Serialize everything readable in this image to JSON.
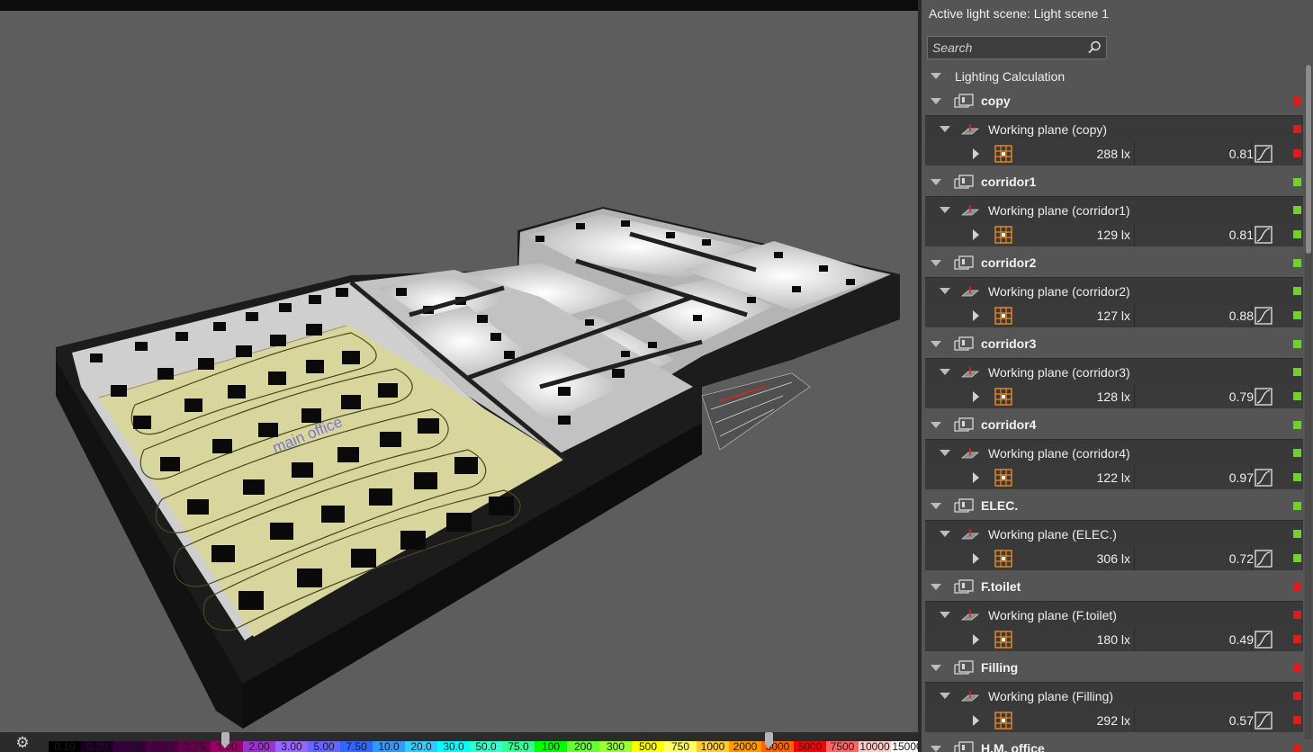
{
  "panel": {
    "active_scene_label": "Active light scene: Light scene 1",
    "search_placeholder": "Search"
  },
  "tree": {
    "calc_label": "Lighting Calculation",
    "status_colors": {
      "red": "#e11b1b",
      "green": "#6fd22a"
    },
    "items": [
      {
        "name": "copy",
        "plane": "Working plane (copy)",
        "lux": "288 lx",
        "uniformity": "0.81",
        "status": "red"
      },
      {
        "name": "corridor1",
        "plane": "Working plane (corridor1)",
        "lux": "129 lx",
        "uniformity": "0.81",
        "status": "green"
      },
      {
        "name": "corridor2",
        "plane": "Working plane (corridor2)",
        "lux": "127 lx",
        "uniformity": "0.88",
        "status": "green"
      },
      {
        "name": "corridor3",
        "plane": "Working plane (corridor3)",
        "lux": "128 lx",
        "uniformity": "0.79",
        "status": "green"
      },
      {
        "name": "corridor4",
        "plane": "Working plane (corridor4)",
        "lux": "122 lx",
        "uniformity": "0.97",
        "status": "green"
      },
      {
        "name": "ELEC.",
        "plane": "Working plane (ELEC.)",
        "lux": "306 lx",
        "uniformity": "0.72",
        "status": "green"
      },
      {
        "name": "F.toilet",
        "plane": "Working plane (F.toilet)",
        "lux": "180 lx",
        "uniformity": "0.49",
        "status": "red"
      },
      {
        "name": "Filling",
        "plane": "Working plane (Filling)",
        "lux": "292 lx",
        "uniformity": "0.57",
        "status": "red"
      },
      {
        "name": "H.M. office",
        "status": "red"
      }
    ]
  },
  "viewport": {
    "room_label": "main office"
  },
  "color_scale": [
    {
      "label": "0.10",
      "color": "#000000"
    },
    {
      "label": "0.20",
      "color": "#1a0020"
    },
    {
      "label": "0.30",
      "color": "#33003c"
    },
    {
      "label": "0.50",
      "color": "#4c0044"
    },
    {
      "label": "0.75",
      "color": "#66004c"
    },
    {
      "label": "1.00",
      "color": "#990066"
    },
    {
      "label": "2.00",
      "color": "#9933cc"
    },
    {
      "label": "3.00",
      "color": "#9966ff"
    },
    {
      "label": "5.00",
      "color": "#6666ff"
    },
    {
      "label": "7.50",
      "color": "#3366ff"
    },
    {
      "label": "10.0",
      "color": "#3399ff"
    },
    {
      "label": "20.0",
      "color": "#33ccff"
    },
    {
      "label": "30.0",
      "color": "#00ffff"
    },
    {
      "label": "50.0",
      "color": "#33ffcc"
    },
    {
      "label": "75.0",
      "color": "#33ff99"
    },
    {
      "label": "100",
      "color": "#00ff00"
    },
    {
      "label": "200",
      "color": "#66ff33"
    },
    {
      "label": "300",
      "color": "#99ff33"
    },
    {
      "label": "500",
      "color": "#ffff00"
    },
    {
      "label": "750",
      "color": "#ffff66"
    },
    {
      "label": "1000",
      "color": "#ffcc33"
    },
    {
      "label": "2000",
      "color": "#ff9900"
    },
    {
      "label": "3000",
      "color": "#ff6600"
    },
    {
      "label": "5000",
      "color": "#ff0000"
    },
    {
      "label": "7500",
      "color": "#ff6666"
    },
    {
      "label": "10000",
      "color": "#ffcccc"
    },
    {
      "label": "15000",
      "color": "#ffffff"
    }
  ]
}
